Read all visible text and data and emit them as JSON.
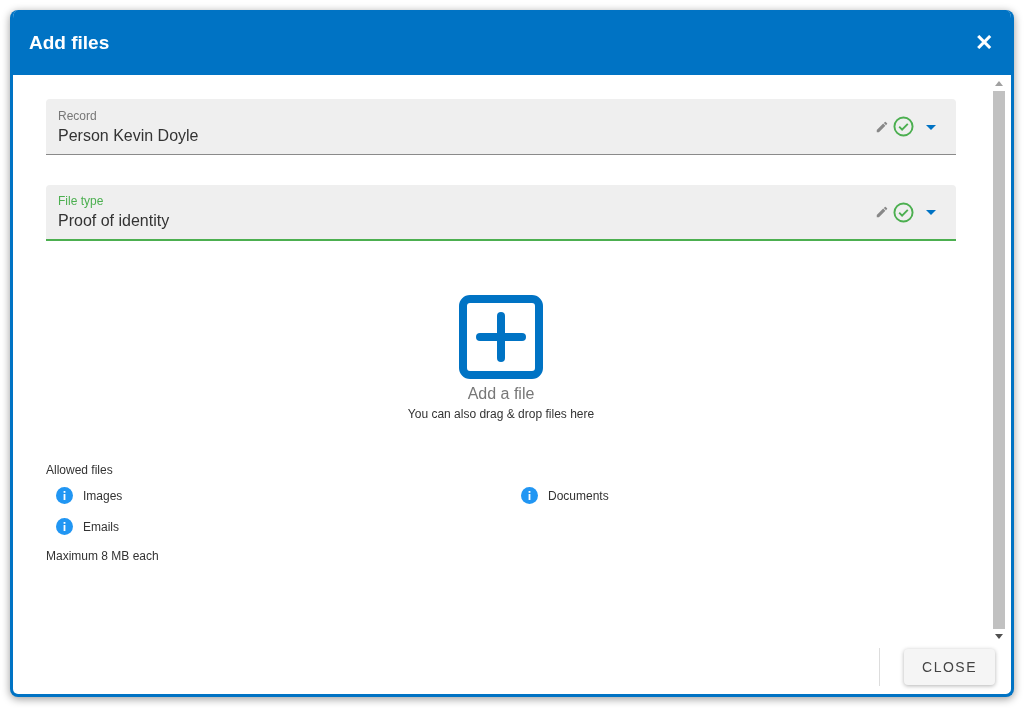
{
  "dialog": {
    "title": "Add files",
    "close_icon": "✕"
  },
  "fields": [
    {
      "label": "Record",
      "value": "Person Kevin Doyle",
      "focused": false
    },
    {
      "label": "File type",
      "value": "Proof of identity",
      "focused": true
    }
  ],
  "upload": {
    "title": "Add a file",
    "hint": "You can also drag & drop files here"
  },
  "allowed": {
    "title": "Allowed files",
    "types": [
      "Images",
      "Documents",
      "Emails"
    ],
    "limit": "Maximum 8 MB each"
  },
  "footer": {
    "button": "CLOSE"
  }
}
